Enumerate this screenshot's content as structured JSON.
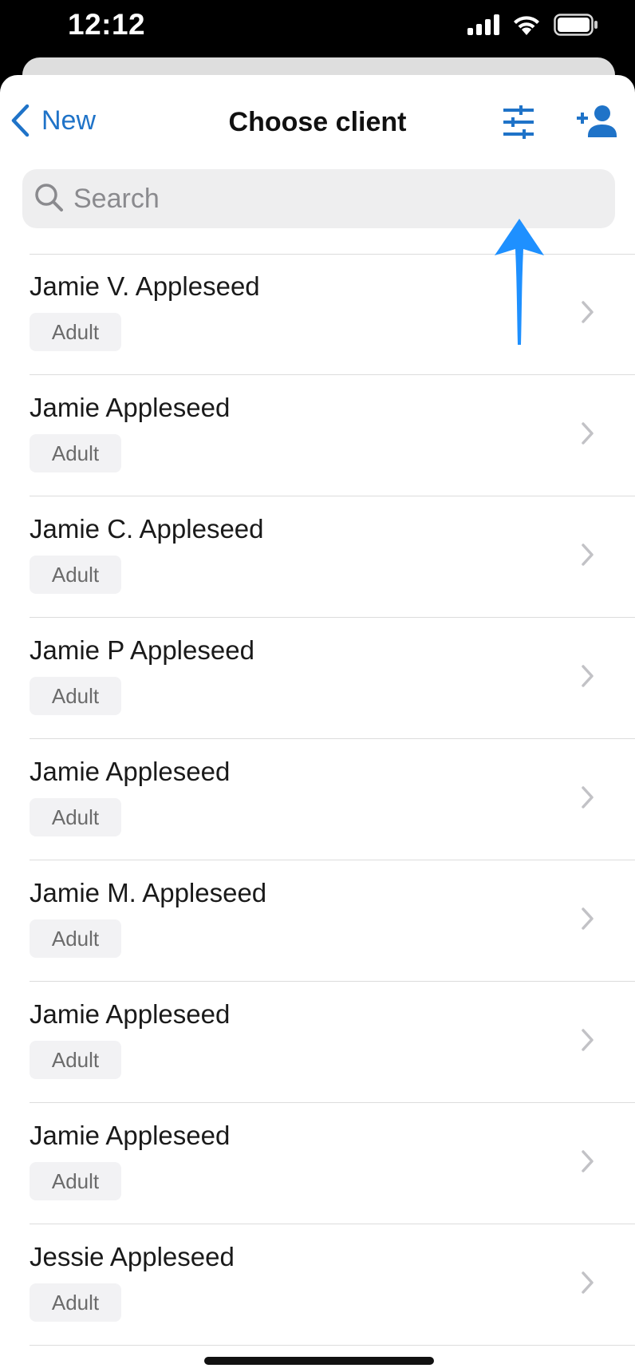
{
  "status_bar": {
    "time": "12:12",
    "icons": [
      "cellular-signal-icon",
      "wifi-icon",
      "battery-icon"
    ]
  },
  "nav": {
    "back_label": "New",
    "title": "Choose client",
    "filter_icon": "sliders-filter-icon",
    "add_icon": "add-person-icon"
  },
  "search": {
    "placeholder": "Search",
    "value": ""
  },
  "clients": [
    {
      "name": "Jamie V. Appleseed",
      "tag": "Adult"
    },
    {
      "name": "Jamie Appleseed",
      "tag": "Adult"
    },
    {
      "name": "Jamie C. Appleseed",
      "tag": "Adult"
    },
    {
      "name": "Jamie P Appleseed",
      "tag": "Adult"
    },
    {
      "name": "Jamie Appleseed",
      "tag": "Adult"
    },
    {
      "name": "Jamie M. Appleseed",
      "tag": "Adult"
    },
    {
      "name": "Jamie Appleseed",
      "tag": "Adult"
    },
    {
      "name": "Jamie Appleseed",
      "tag": "Adult"
    },
    {
      "name": "Jessie Appleseed",
      "tag": "Adult"
    }
  ],
  "colors": {
    "accent": "#1f73c8",
    "annotation_arrow": "#1e90ff",
    "tag_background": "#f2f2f4",
    "search_background": "#eeeeef"
  }
}
